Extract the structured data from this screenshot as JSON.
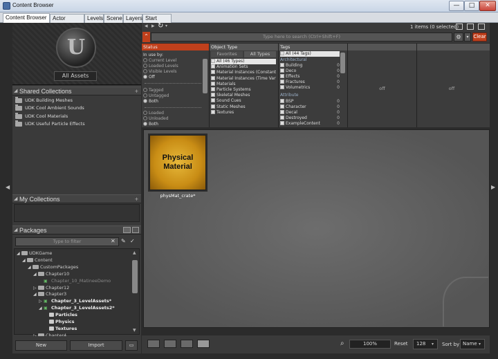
{
  "window": {
    "title": "Content Browser",
    "minimize": "—",
    "maximize": "□",
    "close": "✕"
  },
  "tabs": [
    "Content Browser",
    "Actor Classes",
    "Levels",
    "Scene",
    "Layers",
    "Start Page"
  ],
  "header": {
    "items_count": "1 items (0 selected)"
  },
  "search": {
    "placeholder": "Type here to search (Ctrl+Shift+F)",
    "clear_label": "Clear"
  },
  "sidebar": {
    "all_assets": "All Assets",
    "shared_collections_title": "Shared Collections",
    "shared_collections": [
      "UDK Building Meshes",
      "UDK Cool Ambient Sounds",
      "UDK Cool Materials",
      "UDK Useful Particle Effects"
    ],
    "my_collections_title": "My Collections",
    "packages_title": "Packages",
    "packages_filter_placeholder": "Type to filter",
    "tree": [
      {
        "label": "UDKGame",
        "indent": 0,
        "type": "folder",
        "exp": "◢"
      },
      {
        "label": "Content",
        "indent": 1,
        "type": "folder",
        "exp": "◢"
      },
      {
        "label": "CustomPackages",
        "indent": 2,
        "type": "folder",
        "exp": "◢"
      },
      {
        "label": "Chapter10",
        "indent": 3,
        "type": "folder",
        "exp": "◢"
      },
      {
        "label": "Chapter_10_MatineeDemo",
        "indent": 4,
        "type": "pkg",
        "exp": "",
        "style": "dim"
      },
      {
        "label": "Chapter12",
        "indent": 3,
        "type": "folder",
        "exp": "▷"
      },
      {
        "label": "Chapter3",
        "indent": 3,
        "type": "folder",
        "exp": "◢"
      },
      {
        "label": "Chapter_3_LevelAssets*",
        "indent": 4,
        "type": "pkg",
        "exp": "▷",
        "style": "bold"
      },
      {
        "label": "Chapter_3_LevelAssets2*",
        "indent": 4,
        "type": "pkg",
        "exp": "◢",
        "style": "bold"
      },
      {
        "label": "Particles",
        "indent": 5,
        "type": "sub",
        "exp": "",
        "style": "bold"
      },
      {
        "label": "Physics",
        "indent": 5,
        "type": "sub",
        "exp": "",
        "style": "bold"
      },
      {
        "label": "Textures",
        "indent": 5,
        "type": "sub",
        "exp": "",
        "style": "bold"
      },
      {
        "label": "Chapter4",
        "indent": 3,
        "type": "folder",
        "exp": "▷"
      }
    ],
    "new_label": "New",
    "import_label": "Import"
  },
  "filters": {
    "status": {
      "title": "Status",
      "group1_title": "In use by:",
      "group1": [
        "Current Level",
        "Loaded Levels",
        "Visible Levels",
        "Off"
      ],
      "group2": [
        "Tagged",
        "Untagged",
        "Both"
      ],
      "group3": [
        "Loaded",
        "Unloaded",
        "Both"
      ]
    },
    "object_type": {
      "title": "Object Type",
      "tab_favorites": "Favorites",
      "tab_all_types": "All Types",
      "items": [
        "All (46 Types)",
        "Animation Sets",
        "Material Instances (Constant)",
        "Material Instances (Time Varying)",
        "Materials",
        "Particle Systems",
        "Skeletal Meshes",
        "Sound Cues",
        "Static Meshes",
        "Textures"
      ]
    },
    "tags": {
      "title": "Tags",
      "all": "All (44 Tags)",
      "group1_title": "Architectural",
      "group1": [
        {
          "name": "Building",
          "count": "0"
        },
        {
          "name": "Deco",
          "count": "0"
        },
        {
          "name": "Effects",
          "count": "0"
        },
        {
          "name": "Fractures",
          "count": "0"
        },
        {
          "name": "Volumetrics",
          "count": "0"
        }
      ],
      "group2_title": "Attribute",
      "group2": [
        {
          "name": "BSP",
          "count": "0"
        },
        {
          "name": "Character",
          "count": "0"
        },
        {
          "name": "Decal",
          "count": "0"
        },
        {
          "name": "Destroyed",
          "count": "0"
        },
        {
          "name": "ExampleContent",
          "count": "0"
        }
      ]
    },
    "off1": "off",
    "off2": "off"
  },
  "asset": {
    "thumb_text": "Physical Material",
    "label": "physMat_crate*"
  },
  "bottom": {
    "zoom": "100%",
    "reset": "Reset",
    "size": "128",
    "sort_label": "Sort by",
    "sort_value": "Name"
  }
}
